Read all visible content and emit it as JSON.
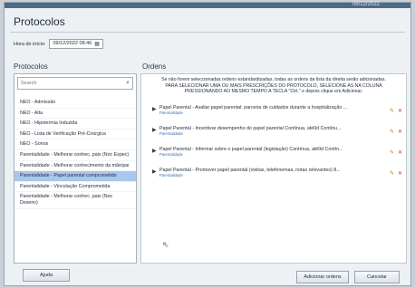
{
  "window": {
    "title": "Protocolos",
    "top_strip_text": "09/12/2022"
  },
  "datetime": {
    "label": "Hora de início:",
    "value": "09/12/2022 08:46",
    "icon": "calendar-icon"
  },
  "left": {
    "header": "Protocolos",
    "search_placeholder": "Search",
    "items": [
      {
        "label": "NEO - Admissão",
        "selected": false
      },
      {
        "label": "NEO - Alta",
        "selected": false
      },
      {
        "label": "NEO - Hipotermia Induzida",
        "selected": false
      },
      {
        "label": "NEO - Lista de Verificação Pré-Cirúrgica",
        "selected": false
      },
      {
        "label": "NEO - Sonos",
        "selected": false
      },
      {
        "label": "Parentalidade - Melhorar conhec. pais (Noc Espec)",
        "selected": false
      },
      {
        "label": "Parentalidade - Melhorar conhecimento da mãe/pai",
        "selected": false
      },
      {
        "label": "Parentalidade - Papel parental comprometido",
        "selected": true
      },
      {
        "label": "Parentalidade - Vinculação Comprometida",
        "selected": false
      },
      {
        "label": "Parentalidade - Melhorar conhec. pais (Noc Desenv)",
        "selected": false
      }
    ]
  },
  "right": {
    "header": "Ordens",
    "info_line1": "Se não forem seleccionadas ordens estandardizadas, todas as ordens da lista da direita serão adicionadas.",
    "info_line2": "PARA SELECIONAR UMA OU MAIS PRESCRIÇÕES DO PROTOCOLO, SELECIONE AS NA COLUNA",
    "info_line3": "PRESSIONANDO AO MESMO TEMPO A TECLA \"Ctrl.\" e depois clique em Adicionar.",
    "orders": [
      {
        "title": "Papel Parental - Avaliar papel parental: parceria de cuidados durante a hospitalização ...",
        "sub": "Parentalidade"
      },
      {
        "title": "Papel Parental - Incentivar desempenho do papel parental     Contínua, até0d Contínu...",
        "sub": "Parentalidade"
      },
      {
        "title": "Papel Parental - Informar sobre o papel parental (legislação)     Contínua, até0d Contín...",
        "sub": "Parentalidade"
      },
      {
        "title": "Papel Parental - Promover papel parental (visitas, telefonemas, notas relevantes)   8...",
        "sub": "Parentalidade"
      }
    ]
  },
  "buttons": {
    "help": "Ajuda",
    "add": "Adicionar ordens",
    "cancel": "Cancelar"
  }
}
